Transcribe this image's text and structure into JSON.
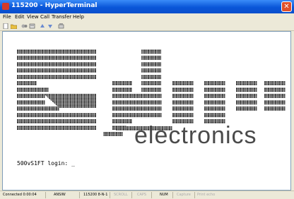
{
  "window": {
    "title": "115200 - HyperTerminal"
  },
  "menu": [
    "File",
    "Edit",
    "View",
    "Call",
    "Transfer",
    "Help"
  ],
  "toolbar": [
    "new-connection-icon",
    "open-icon",
    "disconnect-icon",
    "properties-icon",
    "send-icon",
    "receive-icon",
    "call-icon"
  ],
  "terminal": {
    "logo_text": "electronics",
    "prompt": "500vS1FT login: _"
  },
  "statusbar": {
    "connected": "Connected 0:00:04",
    "emulation": "ANSIW",
    "settings": "115200 8-N-1",
    "scroll": "SCROLL",
    "caps": "CAPS",
    "num": "NUM",
    "capture": "Capture",
    "printecho": "Print echo"
  },
  "colors": {
    "title_bar": "#0a56d8",
    "window_bg": "#ece9d8",
    "terminal_bg": "#ffffff",
    "logo_text": "#4a4a4a"
  }
}
